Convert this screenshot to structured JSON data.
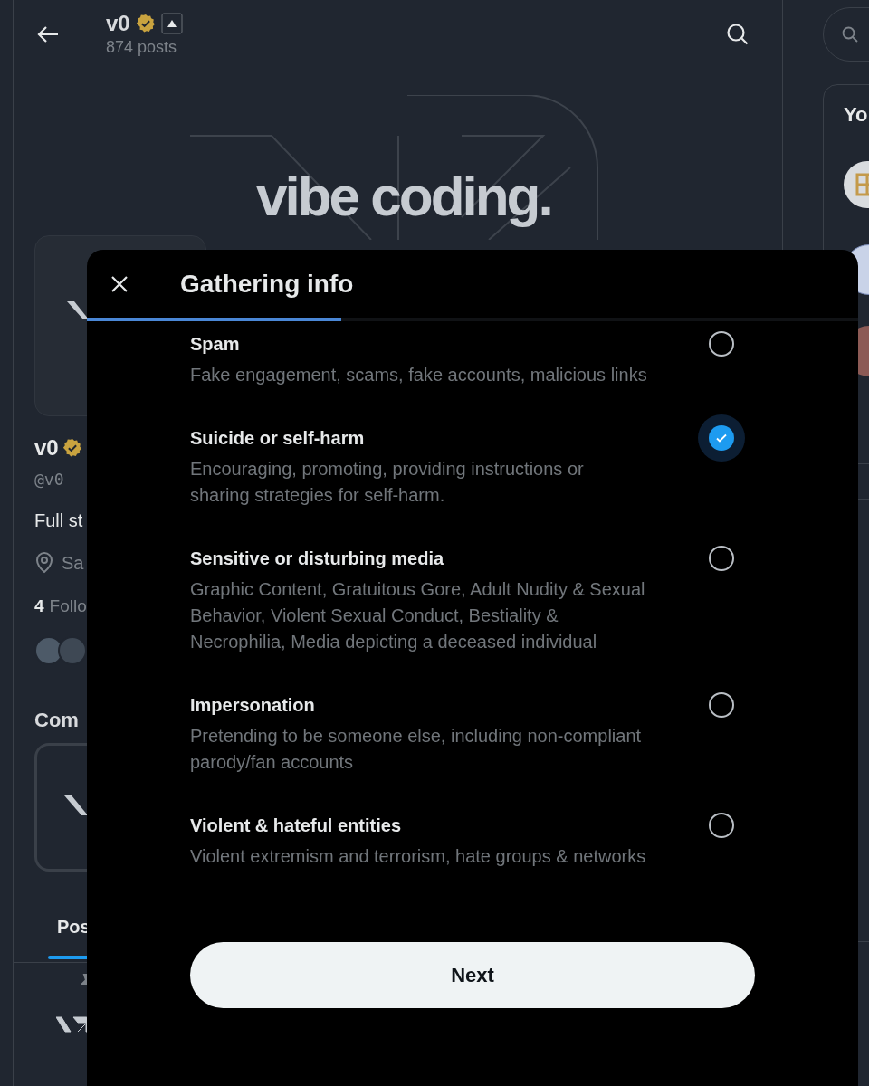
{
  "header": {
    "title": "v0",
    "post_count": "874 posts"
  },
  "banner": {
    "headline": "vibe coding."
  },
  "profile": {
    "name": "v0",
    "handle": "@v0",
    "bio": "Full st",
    "location": "Sa",
    "followers_count": "4",
    "followers_label": "Follo",
    "section_title": "Com",
    "tab": {
      "label": "Pos",
      "selected": true
    }
  },
  "right_column": {
    "card_title": "Yo"
  },
  "dialog": {
    "title": "Gathering info",
    "progress": {
      "level": 0.33
    },
    "options": [
      {
        "title": "Spam",
        "description": "Fake engagement, scams, fake accounts, malicious links",
        "selected": false
      },
      {
        "title": "Suicide or self-harm",
        "description": "Encouraging, promoting, providing instructions or sharing strategies for self-harm.",
        "selected": true
      },
      {
        "title": "Sensitive or disturbing media",
        "description": "Graphic Content, Gratuitous Gore, Adult Nudity & Sexual Behavior, Violent Sexual Conduct, Bestiality & Necrophilia, Media depicting a deceased individual",
        "selected": false
      },
      {
        "title": "Impersonation",
        "description": "Pretending to be someone else, including non-compliant parody/fan accounts",
        "selected": false
      },
      {
        "title": "Violent & hateful entities",
        "description": "Violent extremism and terrorism, hate groups & networks",
        "selected": false
      }
    ],
    "button": "Next"
  }
}
